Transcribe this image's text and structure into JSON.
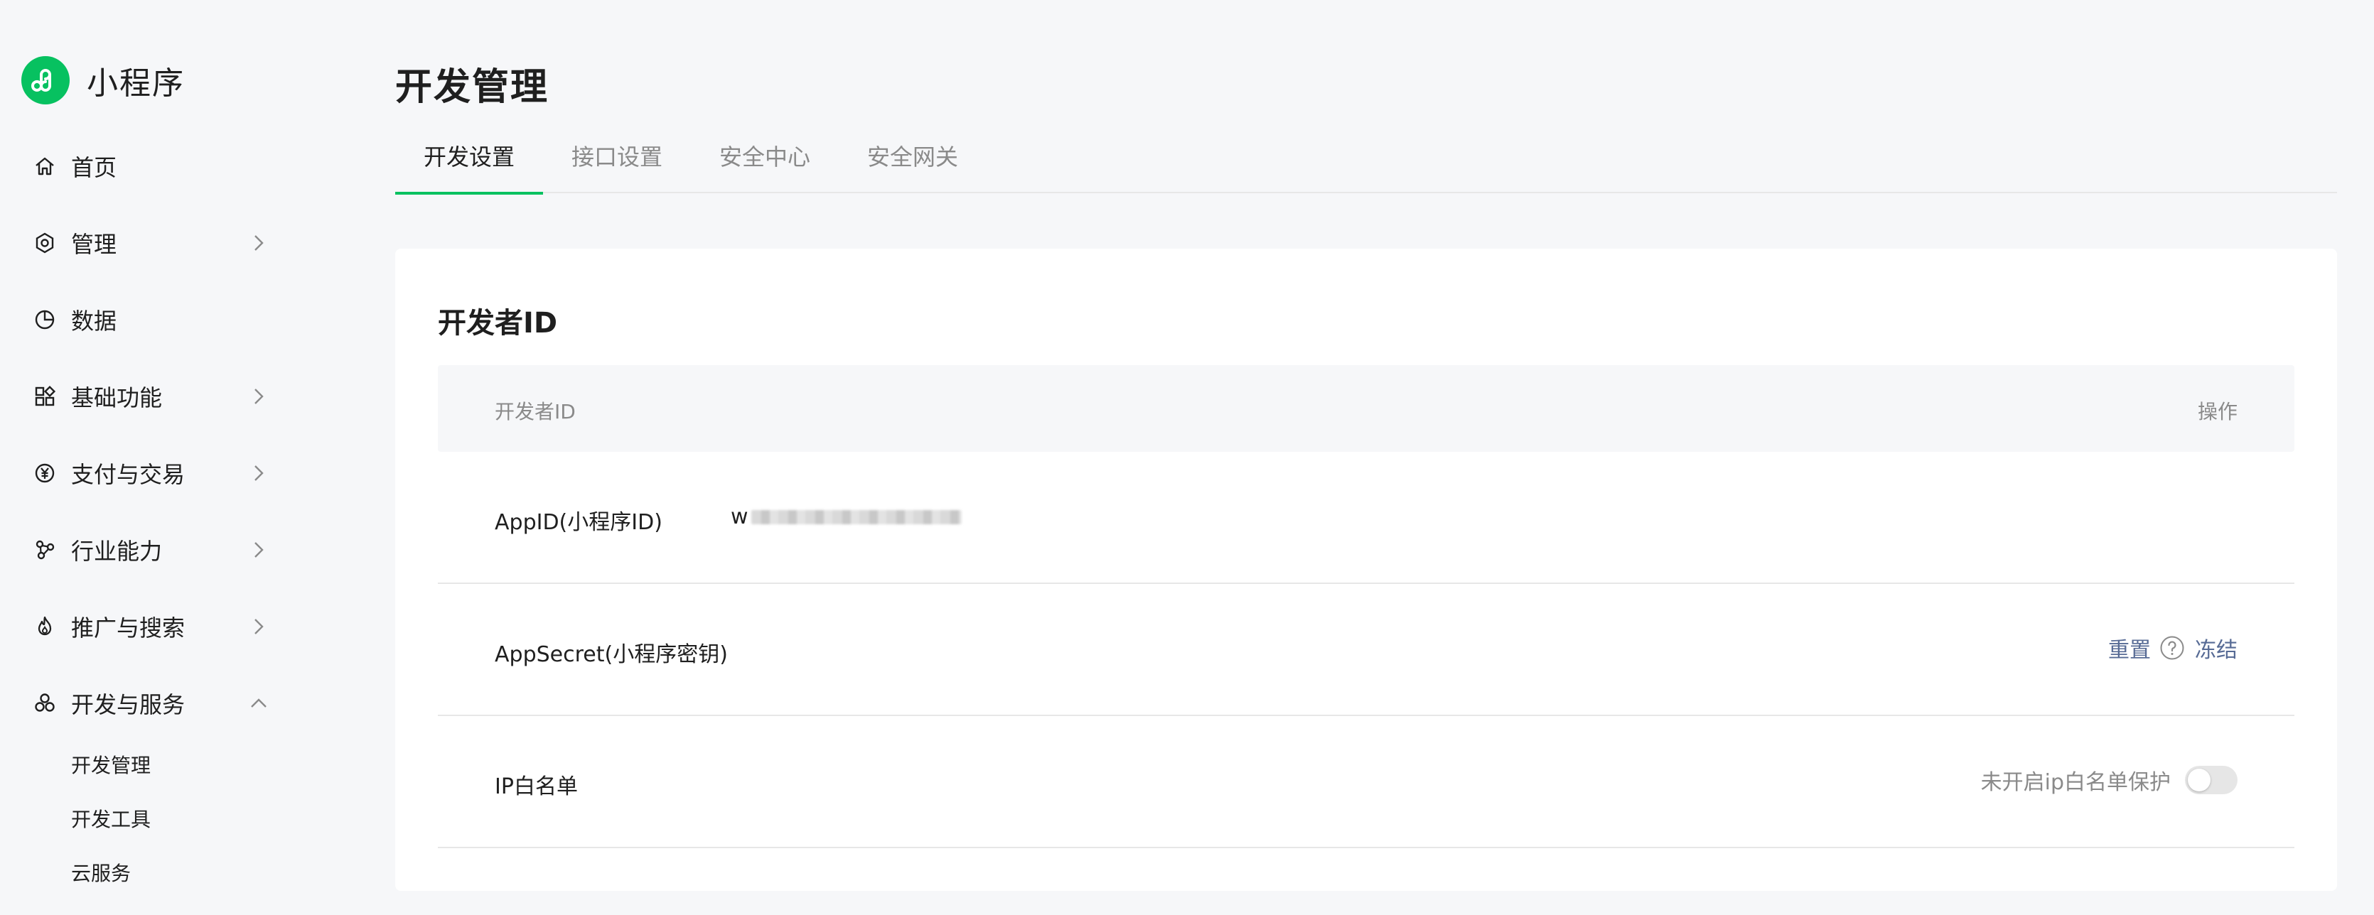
{
  "brand": {
    "name": "小程序",
    "logo_icon": "mini-program-logo-icon",
    "accent": "#07c160"
  },
  "sidebar": {
    "items": [
      {
        "label": "首页",
        "icon": "home-icon",
        "has_chevron": false
      },
      {
        "label": "管理",
        "icon": "hexagon-settings-icon",
        "has_chevron": true,
        "chevron": "right"
      },
      {
        "label": "数据",
        "icon": "pie-chart-icon",
        "has_chevron": false
      },
      {
        "label": "基础功能",
        "icon": "grid-apps-icon",
        "has_chevron": true,
        "chevron": "right"
      },
      {
        "label": "支付与交易",
        "icon": "yuan-circle-icon",
        "has_chevron": true,
        "chevron": "right"
      },
      {
        "label": "行业能力",
        "icon": "molecule-icon",
        "has_chevron": true,
        "chevron": "right"
      },
      {
        "label": "推广与搜索",
        "icon": "flame-icon",
        "has_chevron": true,
        "chevron": "right"
      },
      {
        "label": "开发与服务",
        "icon": "three-circles-icon",
        "has_chevron": true,
        "chevron": "up",
        "expanded": true
      }
    ],
    "subitems": [
      {
        "label": "开发管理",
        "active": true
      },
      {
        "label": "开发工具"
      },
      {
        "label": "云服务"
      }
    ]
  },
  "page": {
    "title": "开发管理"
  },
  "tabs": [
    {
      "label": "开发设置",
      "active": true
    },
    {
      "label": "接口设置"
    },
    {
      "label": "安全中心"
    },
    {
      "label": "安全网关"
    }
  ],
  "card": {
    "title": "开发者ID",
    "table": {
      "headers": {
        "left": "开发者ID",
        "right": "操作"
      },
      "rows": [
        {
          "label": "AppID(小程序ID)",
          "value_prefix": "w",
          "value_blurred": true
        },
        {
          "label": "AppSecret(小程序密钥)",
          "actions": {
            "reset": "重置",
            "help_icon": "question-circle-icon",
            "freeze": "冻结"
          }
        },
        {
          "label": "IP白名单",
          "status": "未开启ip白名单保护",
          "toggle_on": false
        }
      ]
    }
  },
  "colors": {
    "link": "#576b95",
    "muted": "#8a8a8a",
    "text": "#1f1f1f",
    "background": "#f6f7f9"
  }
}
